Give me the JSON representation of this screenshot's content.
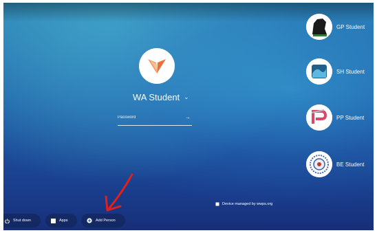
{
  "login": {
    "user_name": "WA Student",
    "password_placeholder": "Password"
  },
  "users": [
    {
      "name": "GP Student",
      "avatar_icon": "panther-avatar-icon"
    },
    {
      "name": "SH Student",
      "avatar_icon": "wave-avatar-icon"
    },
    {
      "name": "PP Student",
      "avatar_icon": "pp-avatar-icon"
    },
    {
      "name": "BE Student",
      "avatar_icon": "seal-avatar-icon"
    }
  ],
  "device_note": "Device managed by wwps.org",
  "shelf": {
    "shutdown_label": "Shut down",
    "apps_label": "Apps",
    "add_person_label": "Add Person"
  },
  "colors": {
    "background_top": "#2d86b8",
    "background_bottom": "#172f7a",
    "arrow_annotation": "#e0201e",
    "main_avatar_orange": "#f08a4b"
  }
}
